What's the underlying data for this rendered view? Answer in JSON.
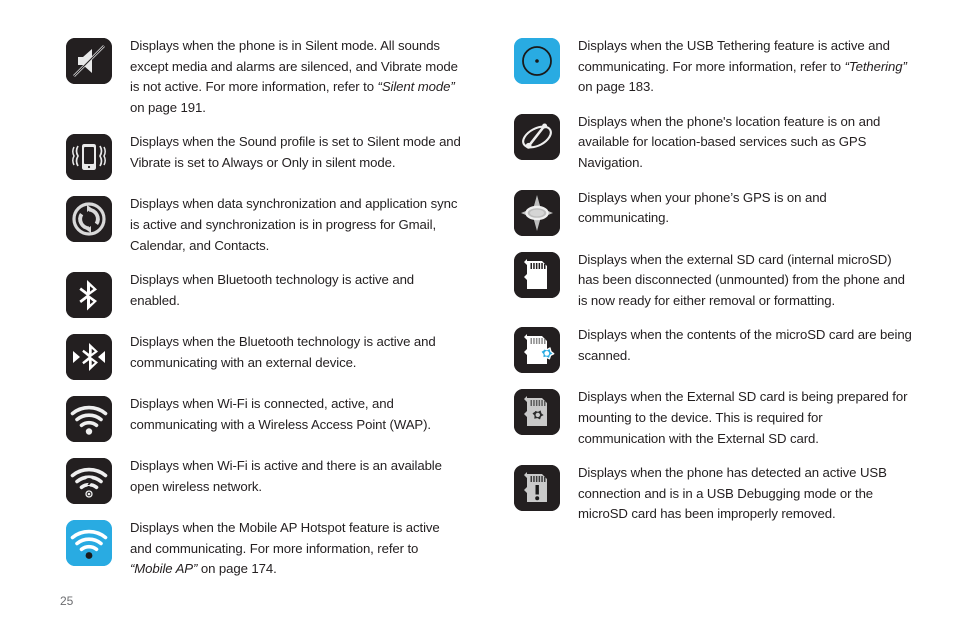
{
  "page": {
    "number": "25"
  },
  "columns": {
    "left": {
      "rows": [
        {
          "icon": "silent-mode-icon",
          "icon_color": "#231f20",
          "text_parts": [
            {
              "style": "normal",
              "text": "Displays when the phone is in Silent mode. All sounds except media and alarms are silenced, and Vibrate mode is not active.  For more information, refer to "
            },
            {
              "style": "italic",
              "text": "“Silent mode”"
            },
            {
              "style": "normal",
              "text": "  on page 191."
            }
          ]
        },
        {
          "icon": "vibrate-mode-icon",
          "icon_color": "#231f20",
          "text_parts": [
            {
              "style": "normal",
              "text": "Displays when the Sound profile is set to Silent mode and Vibrate is set to Always or Only in silent mode."
            }
          ]
        },
        {
          "icon": "sync-active-icon",
          "icon_color": "#231f20",
          "text_parts": [
            {
              "style": "normal",
              "text": "Displays when data synchronization and application sync is active and synchronization is in progress for Gmail, Calendar, and Contacts."
            }
          ]
        },
        {
          "icon": "bluetooth-active-icon",
          "icon_color": "#231f20",
          "text_parts": [
            {
              "style": "normal",
              "text": "Displays when Bluetooth technology is active and enabled."
            }
          ]
        },
        {
          "icon": "bluetooth-connected-icon",
          "icon_color": "#231f20",
          "text_parts": [
            {
              "style": "normal",
              "text": "Displays when the Bluetooth technology is active and communicating with an external device."
            }
          ]
        },
        {
          "icon": "wifi-connected-icon",
          "icon_color": "#231f20",
          "text_parts": [
            {
              "style": "normal",
              "text": "Displays when Wi-Fi is connected, active, and communicating with a Wireless Access Point (WAP)."
            }
          ]
        },
        {
          "icon": "wifi-open-network-icon",
          "icon_color": "#231f20",
          "text_parts": [
            {
              "style": "normal",
              "text": "Displays when Wi-Fi is active and there is an available open wireless network."
            }
          ]
        },
        {
          "icon": "mobile-ap-hotspot-icon",
          "icon_color": "#29ABE2",
          "text_parts": [
            {
              "style": "normal",
              "text": "Displays when the Mobile AP Hotspot feature is active and communicating. For more information, refer to "
            },
            {
              "style": "italic",
              "text": "“Mobile AP”"
            },
            {
              "style": "normal",
              "text": "  on page 174."
            }
          ]
        }
      ]
    },
    "right": {
      "rows": [
        {
          "icon": "usb-tethering-icon",
          "icon_color": "#29ABE2",
          "text_parts": [
            {
              "style": "normal",
              "text": "Displays when the USB Tethering feature is active and communicating. For more information, refer to "
            },
            {
              "style": "italic",
              "text": "“Tethering”"
            },
            {
              "style": "normal",
              "text": "  on page 183."
            }
          ]
        },
        {
          "icon": "location-service-icon",
          "icon_color": "#231f20",
          "text_parts": [
            {
              "style": "normal",
              "text": "Displays when the phone's location feature is on and available for location-based services such as GPS Navigation."
            }
          ]
        },
        {
          "icon": "gps-active-icon",
          "icon_color": "#231f20",
          "text_parts": [
            {
              "style": "normal",
              "text": "Displays when your phone’s GPS is on and communicating."
            }
          ]
        },
        {
          "icon": "sd-card-unmounted-icon",
          "icon_color": "#231f20",
          "text_parts": [
            {
              "style": "normal",
              "text": "Displays when the external SD card (internal microSD) has been disconnected (unmounted) from the phone and is now ready for either removal or formatting."
            }
          ]
        },
        {
          "icon": "sd-card-scanning-icon",
          "icon_color": "#231f20",
          "text_parts": [
            {
              "style": "normal",
              "text": "Displays when the contents of the microSD card are being scanned."
            }
          ]
        },
        {
          "icon": "sd-card-preparing-icon",
          "icon_color": "#231f20",
          "text_parts": [
            {
              "style": "normal",
              "text": "Displays when the External SD card is being prepared for mounting to the device. This is required for communication with the External SD card."
            }
          ]
        },
        {
          "icon": "usb-debugging-icon",
          "icon_color": "#231f20",
          "text_parts": [
            {
              "style": "normal",
              "text": "Displays when the phone has detected an active USB connection and is in a USB Debugging mode or the microSD card has been improperly removed."
            }
          ]
        }
      ]
    }
  }
}
